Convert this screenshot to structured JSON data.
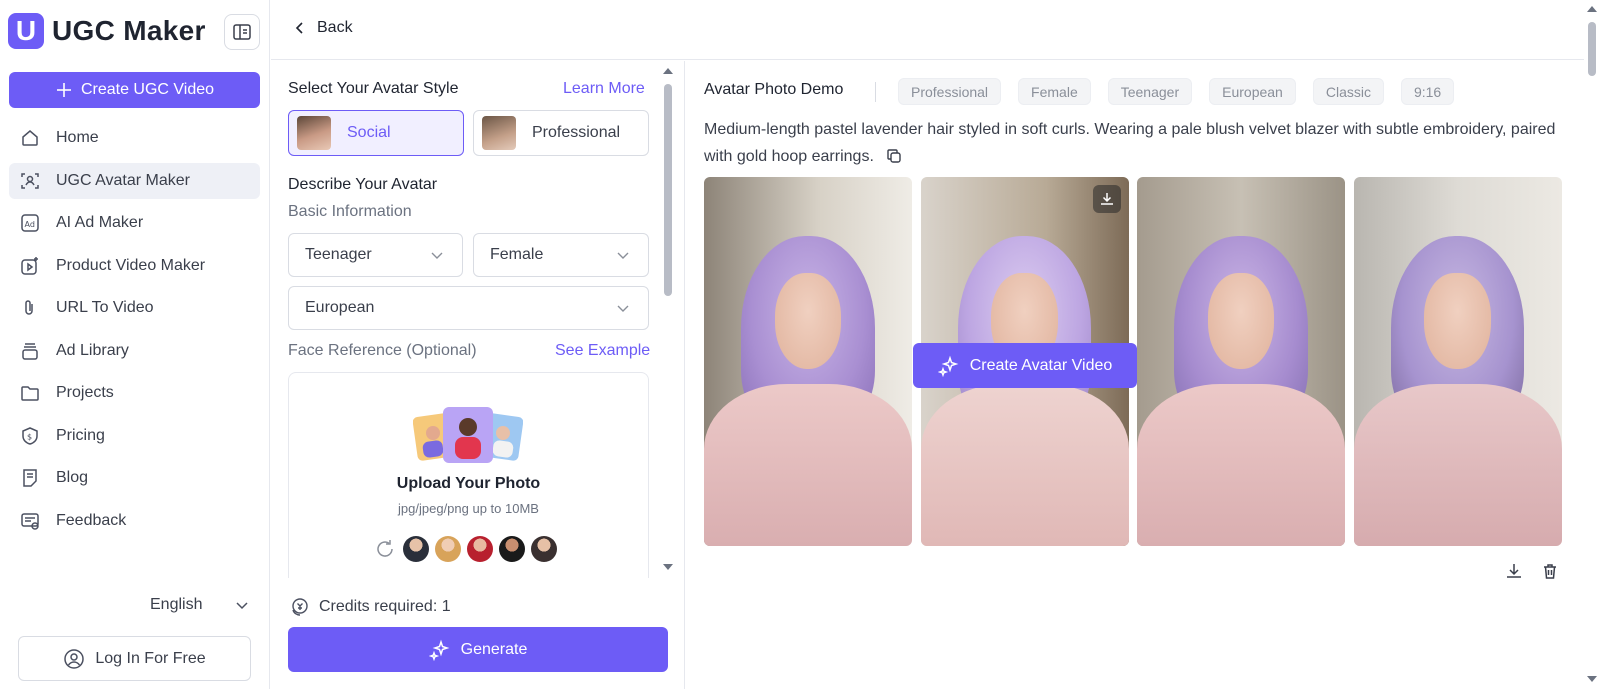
{
  "sidebar": {
    "logo_letter": "U",
    "logo_text": "UGC Maker",
    "create_label": "Create UGC Video",
    "items": [
      {
        "label": "Home",
        "icon": "home-icon"
      },
      {
        "label": "UGC Avatar Maker",
        "icon": "avatar-scan-icon",
        "active": true
      },
      {
        "label": "AI Ad Maker",
        "icon": "ad-icon"
      },
      {
        "label": "Product Video Maker",
        "icon": "product-video-icon"
      },
      {
        "label": "URL To Video",
        "icon": "paperclip-icon"
      },
      {
        "label": "Ad Library",
        "icon": "library-icon"
      },
      {
        "label": "Projects",
        "icon": "folder-icon"
      },
      {
        "label": "Pricing",
        "icon": "pricing-shield-icon"
      },
      {
        "label": "Blog",
        "icon": "blog-icon"
      },
      {
        "label": "Feedback",
        "icon": "feedback-icon"
      }
    ],
    "language": "English",
    "login_label": "Log In For Free"
  },
  "topbar": {
    "back_label": "Back"
  },
  "panel": {
    "style_title": "Select Your Avatar Style",
    "learn_more": "Learn More",
    "styles": [
      {
        "label": "Social",
        "selected": true
      },
      {
        "label": "Professional",
        "selected": false
      }
    ],
    "describe_title": "Describe Your Avatar",
    "basic_info": "Basic Information",
    "age": "Teenager",
    "gender": "Female",
    "ethnicity": "European",
    "face_ref_label": "Face Reference (Optional)",
    "see_example": "See Example",
    "upload_title": "Upload Your Photo",
    "upload_sub": "jpg/jpeg/png up to 10MB",
    "credits": "Credits required: 1",
    "generate_label": "Generate"
  },
  "demo": {
    "title": "Avatar Photo Demo",
    "tags": [
      "Professional",
      "Female",
      "Teenager",
      "European",
      "Classic",
      "9:16"
    ],
    "description": "Medium-length pastel lavender hair styled in soft curls. Wearing a pale blush velvet blazer with subtle embroidery, paired with gold hoop earrings.",
    "create_video_label": "Create Avatar Video"
  },
  "colors": {
    "accent": "#6d5cf6",
    "active_bg": "#eef0f6",
    "border": "#d9dce3"
  }
}
